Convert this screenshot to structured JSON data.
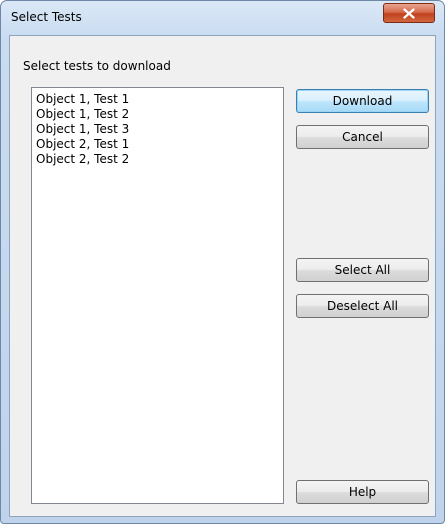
{
  "window": {
    "title": "Select Tests"
  },
  "instruction": "Select tests to download",
  "tests": [
    "Object 1, Test 1",
    "Object 1, Test 2",
    "Object 1, Test 3",
    "Object 2, Test 1",
    "Object 2, Test 2"
  ],
  "buttons": {
    "download": "Download",
    "cancel": "Cancel",
    "select_all": "Select All",
    "deselect_all": "Deselect All",
    "help": "Help"
  },
  "icons": {
    "close": "close-icon"
  },
  "colors": {
    "close_button": "#c94a2a",
    "default_button_border": "#3c7fb1",
    "dialog_background": "#f0f0f0"
  }
}
